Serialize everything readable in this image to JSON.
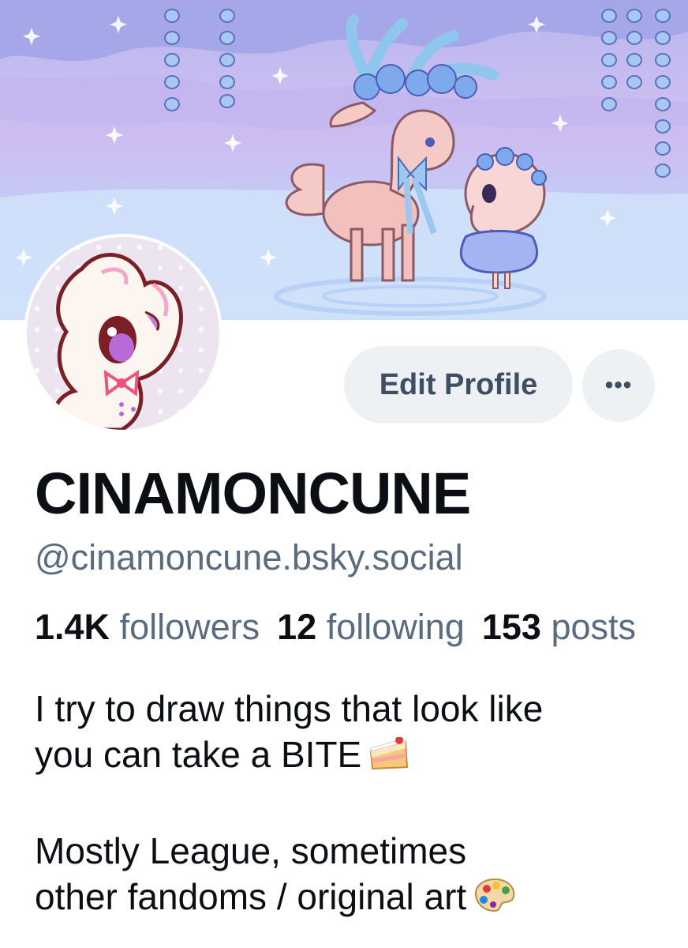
{
  "profile": {
    "display_name": "CINAMONCUNE",
    "handle": "@cinamoncune.bsky.social",
    "stats": {
      "followers_count": "1.4K",
      "followers_label": "followers",
      "following_count": "12",
      "following_label": "following",
      "posts_count": "153",
      "posts_label": "posts"
    },
    "bio": {
      "line1": "I try to draw things that look like",
      "line2": "you can take a BITE",
      "line3": "Mostly League, sometimes",
      "line4": "other fandoms / original art"
    }
  },
  "actions": {
    "edit_profile_label": "Edit Profile",
    "more_label": "•••"
  },
  "icons": {
    "cake": "cake-slice-icon",
    "palette": "palette-icon",
    "more": "ellipsis-icon"
  },
  "colors": {
    "text_primary": "#0b0f14",
    "text_secondary": "#5a6b80",
    "button_bg": "#eef1f4",
    "button_text": "#3f4f63"
  }
}
